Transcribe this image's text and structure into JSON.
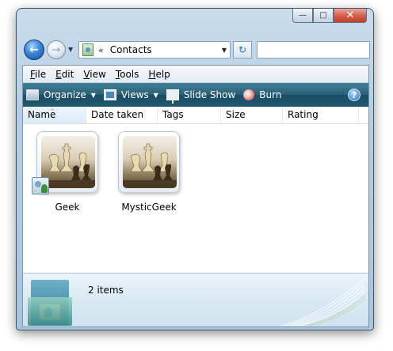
{
  "window": {
    "caption_buttons": {
      "minimize": "—",
      "maximize": "□",
      "close": "✕"
    }
  },
  "nav": {
    "back_glyph": "←",
    "forward_glyph": "→",
    "dropdown_glyph": "▼",
    "refresh_glyph": "↻",
    "address": {
      "chevron": "«",
      "path": "Contacts",
      "dropdown_glyph": "▼"
    },
    "search": {
      "placeholder": ""
    }
  },
  "menu": {
    "items": [
      {
        "underline": "F",
        "rest": "ile"
      },
      {
        "underline": "E",
        "rest": "dit"
      },
      {
        "underline": "V",
        "rest": "iew"
      },
      {
        "underline": "T",
        "rest": "ools"
      },
      {
        "underline": "H",
        "rest": "elp"
      }
    ]
  },
  "toolbar": {
    "organize": "Organize",
    "views": "Views",
    "slideshow": "Slide Show",
    "burn": "Burn",
    "dropdown_glyph": "▼",
    "help_glyph": "?"
  },
  "columns": {
    "sort_glyph": "^",
    "headers": [
      "Name",
      "Date taken",
      "Tags",
      "Size",
      "Rating"
    ]
  },
  "files": [
    {
      "name": "Geek",
      "icon": "contact-overlay-icon"
    },
    {
      "name": "MysticGeek",
      "icon": "none"
    }
  ],
  "details": {
    "item_count": "2 items"
  },
  "colors": {
    "command_bar": "#2c6178",
    "window_chrome": "#b7cfe4",
    "close_button": "#c0402a"
  }
}
